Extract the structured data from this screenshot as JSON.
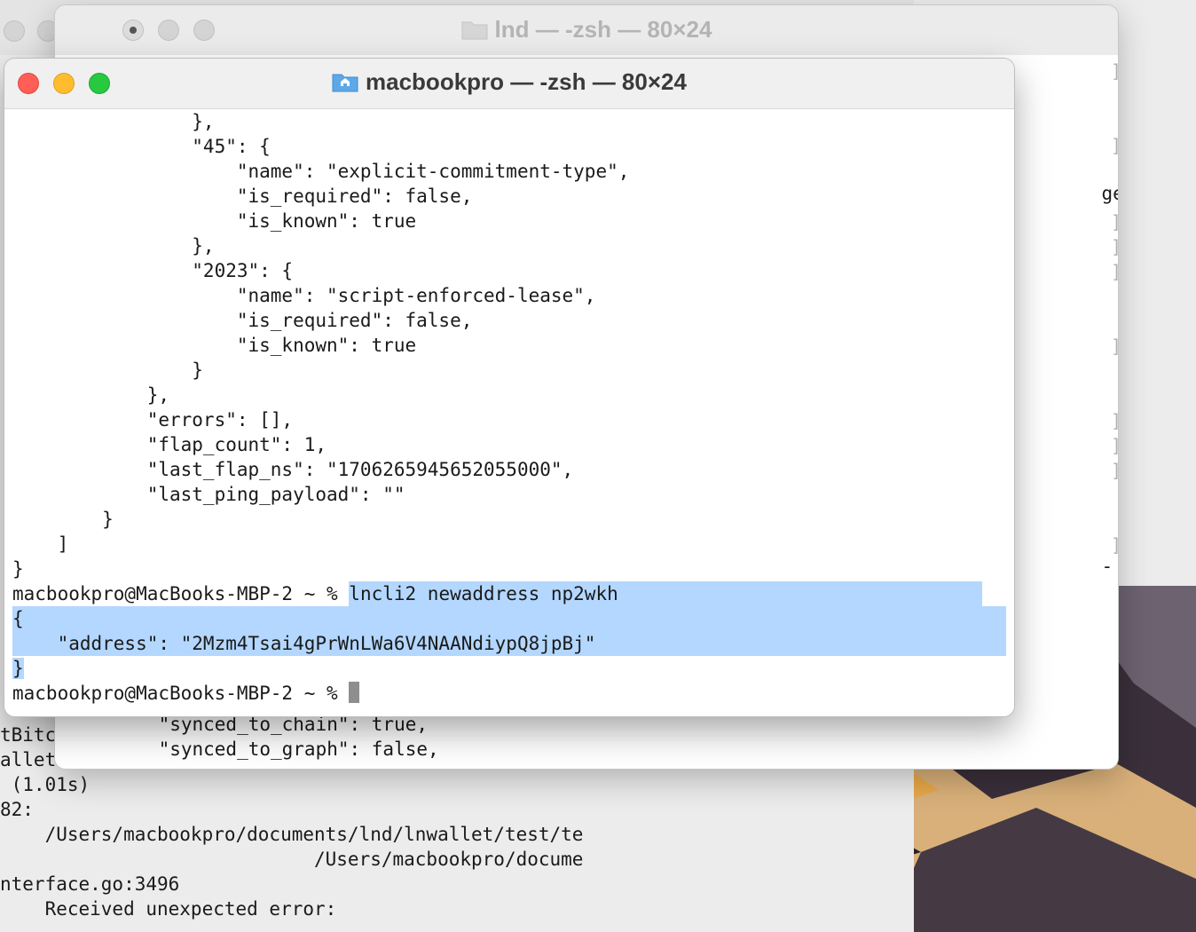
{
  "front_window": {
    "title": "macbookpro — -zsh — 80×24",
    "lines": [
      "                },",
      "                \"45\": {",
      "                    \"name\": \"explicit-commitment-type\",",
      "                    \"is_required\": false,",
      "                    \"is_known\": true",
      "                },",
      "                \"2023\": {",
      "                    \"name\": \"script-enforced-lease\",",
      "                    \"is_required\": false,",
      "                    \"is_known\": true",
      "                }",
      "            },",
      "            \"errors\": [],",
      "            \"flap_count\": 1,",
      "            \"last_flap_ns\": \"1706265945652055000\",",
      "            \"last_ping_payload\": \"\"",
      "        }",
      "    ]",
      "}"
    ],
    "prompt": "macbookpro@MacBooks-MBP-2 ~ % ",
    "command": "lncli2 newaddress np2wkh",
    "output_open": "{",
    "output_address_line": "    \"address\": \"2Mzm4Tsai4gPrWnLWa6V4NAANdiypQ8jpBj\"",
    "output_close": "}",
    "final_prompt": "macbookpro@MacBooks-MBP-2 ~ % "
  },
  "middle_window": {
    "title": "lnd — -zsh — 80×24",
    "visible_right_text_1": "getinfo",
    "visible_right_text_2": "- use a",
    "lines_below": [
      "    \"synced_to_chain\": true,",
      "    \"synced_to_graph\": false,"
    ]
  },
  "back_window": {
    "left_fragments": [
      "tBitc",
      "allet"
    ],
    "lines": [
      " (1.01s)",
      "82:",
      "    /Users/macbookpro/documents/lnd/lnwallet/test/te",
      "",
      "                            /Users/macbookpro/docume",
      "nterface.go:3496",
      "    Received unexpected error:"
    ]
  },
  "colors": {
    "selection": "#b3d7ff",
    "close": "#ff5f57",
    "minimize": "#febc2e",
    "zoom": "#28c840"
  }
}
